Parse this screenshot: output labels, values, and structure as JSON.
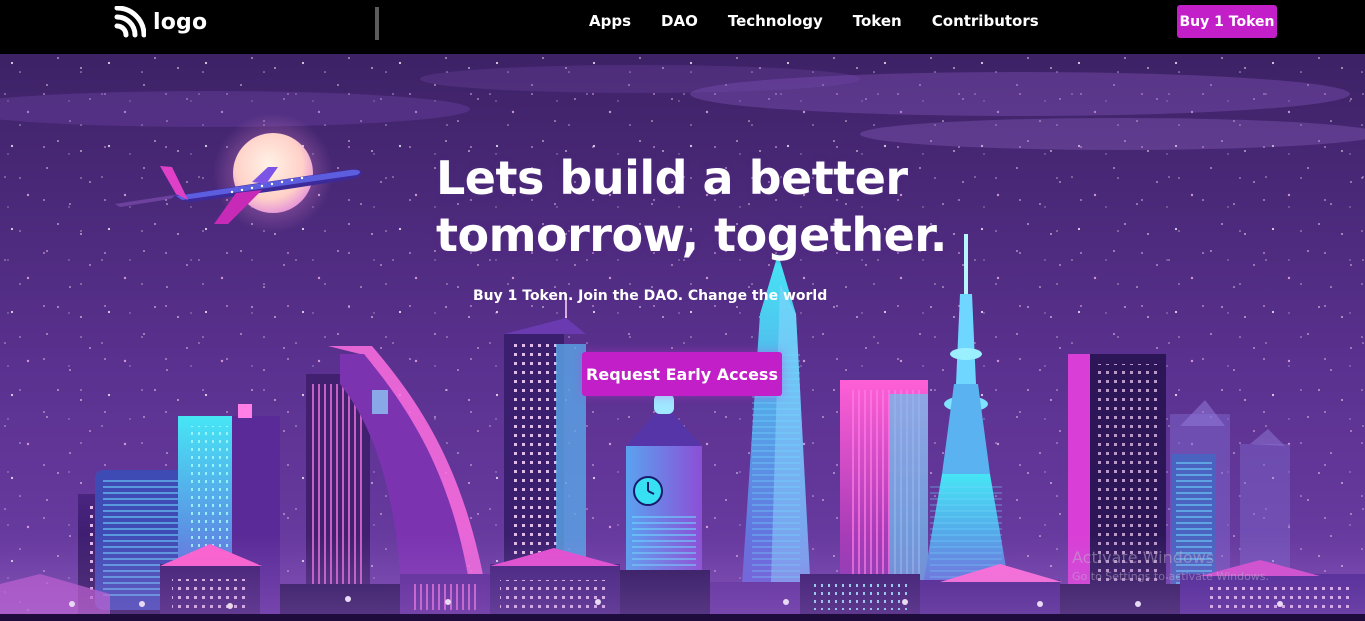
{
  "header": {
    "logo_text": "logo",
    "logo_icon": "rss-icon",
    "nav": [
      {
        "label": "Apps"
      },
      {
        "label": "DAO"
      },
      {
        "label": "Technology"
      },
      {
        "label": "Token"
      },
      {
        "label": "Contributors"
      }
    ],
    "buy_button": "Buy 1 Token"
  },
  "hero": {
    "title_line1": "Lets build a better",
    "title_line2": "tomorrow, together.",
    "subtitle": "Buy 1 Token. Join the DAO. Change the world",
    "cta": "Request Early Access",
    "illustration": "neon-city-skyline-illustration"
  },
  "watermark": {
    "title": "Activate Windows",
    "subtitle": "Go to Settings to activate Windows."
  },
  "colors": {
    "accent": "#c21fc9",
    "navbar": "#000000",
    "sky_top": "#3d2266",
    "sky_bottom": "#6d3ea6"
  }
}
